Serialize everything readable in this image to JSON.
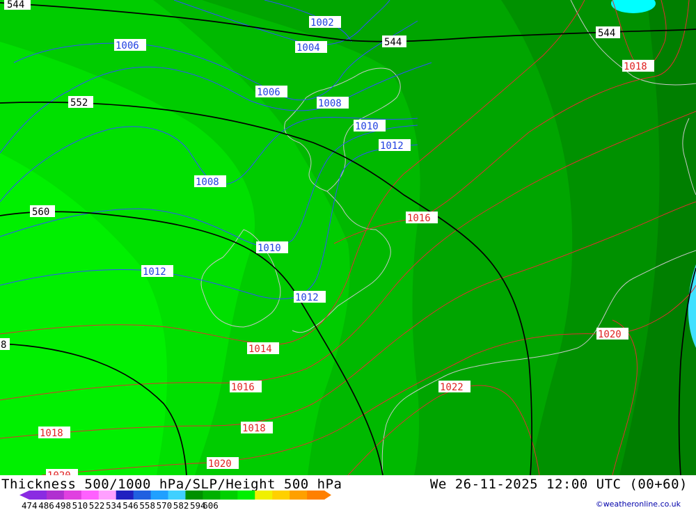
{
  "title": "Thickness 500/1000 hPa/SLP/Height 500 hPa",
  "valid_time": "We 26-11-2025 12:00 UTC (00+60)",
  "credit": "©weatheronline.co.uk",
  "colorbar": {
    "ticks": [
      "474",
      "486",
      "498",
      "510",
      "522",
      "534",
      "546",
      "558",
      "570",
      "582",
      "594",
      "606"
    ],
    "colors": [
      "#8a2be2",
      "#b030d0",
      "#e040e0",
      "#ff60ff",
      "#ffa0ff",
      "#2020c0",
      "#2060e0",
      "#20a0ff",
      "#40d0ff",
      "#009000",
      "#00b000",
      "#00d000",
      "#00f000",
      "#f0f000",
      "#ffd000",
      "#ffa000",
      "#ff8000"
    ]
  },
  "labels": {
    "height_544_a": "544",
    "height_544_b": "544",
    "height_544_c": "544",
    "height_552": "552",
    "height_560": "560",
    "height_8": "8",
    "slp_1002": "1002",
    "slp_1004": "1004",
    "slp_1006_a": "1006",
    "slp_1006_b": "1006",
    "slp_1008_a": "1008",
    "slp_1008_b": "1008",
    "slp_1010_a": "1010",
    "slp_1010_b": "1010",
    "slp_1012_a": "1012",
    "slp_1012_b": "1012",
    "slp_1012_c": "1012",
    "slp_1014": "1014",
    "slp_1016_a": "1016",
    "slp_1016_b": "1016",
    "slp_1018_a": "1018",
    "slp_1018_b": "1018",
    "slp_1018_c": "1018",
    "slp_1020_a": "1020",
    "slp_1020_b": "1020",
    "slp_1020_c": "1020",
    "slp_1022": "1022"
  }
}
